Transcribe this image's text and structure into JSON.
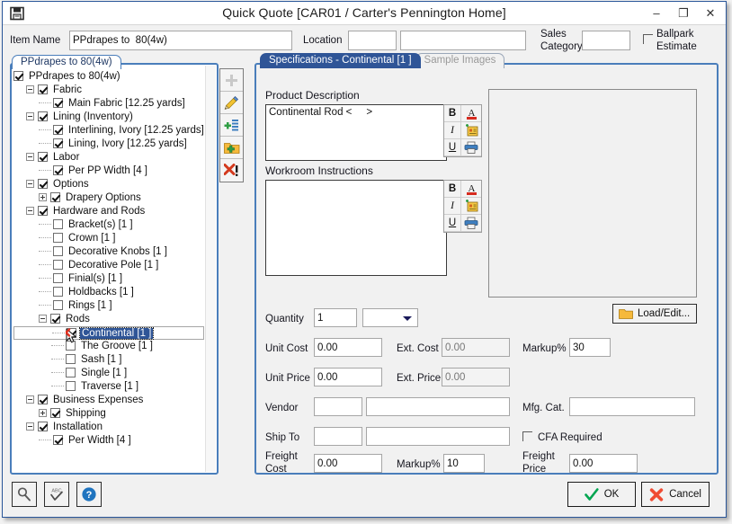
{
  "window": {
    "title": "Quick Quote [CAR01 / Carter's Pennington Home]",
    "icon": "save-disk-icon",
    "minimize": "–",
    "maximize": "❐",
    "close": "✕"
  },
  "header": {
    "item_name_label": "Item Name",
    "item_name_value": "PPdrapes to  80(4w)",
    "location_label": "Location",
    "location_value": "",
    "location_desc_value": "",
    "sales_category_label_line1": "Sales",
    "sales_category_label_line2": "Category",
    "sales_category_value": "",
    "ballpark_label_line1": "Ballpark",
    "ballpark_label_line2": "Estimate",
    "ballpark_checked": false
  },
  "tree": {
    "tab_label": "PPdrapes to  80(4w)",
    "nodes": [
      {
        "label": "PPdrapes to  80(4w)",
        "indent": 0,
        "expander": "none",
        "checked": true,
        "selected": false,
        "dots": false
      },
      {
        "label": "Fabric",
        "indent": 1,
        "expander": "minus",
        "checked": true,
        "selected": false,
        "dots": false
      },
      {
        "label": "Main Fabric [12.25 yards]",
        "indent": 2,
        "expander": "none",
        "checked": true,
        "selected": false,
        "dots": true
      },
      {
        "label": "Lining (Inventory)",
        "indent": 1,
        "expander": "minus",
        "checked": true,
        "selected": false,
        "dots": false
      },
      {
        "label": "Interlining, Ivory [12.25 yards]",
        "indent": 2,
        "expander": "none",
        "checked": true,
        "selected": false,
        "dots": true
      },
      {
        "label": "Lining, Ivory [12.25 yards]",
        "indent": 2,
        "expander": "none",
        "checked": true,
        "selected": false,
        "dots": true
      },
      {
        "label": "Labor",
        "indent": 1,
        "expander": "minus",
        "checked": true,
        "selected": false,
        "dots": false
      },
      {
        "label": "Per PP Width [4 ]",
        "indent": 2,
        "expander": "none",
        "checked": true,
        "selected": false,
        "dots": true
      },
      {
        "label": "Options",
        "indent": 1,
        "expander": "minus",
        "checked": true,
        "selected": false,
        "dots": false
      },
      {
        "label": "Drapery Options",
        "indent": 2,
        "expander": "plus",
        "checked": true,
        "selected": false,
        "dots": false
      },
      {
        "label": "Hardware and Rods",
        "indent": 1,
        "expander": "minus",
        "checked": true,
        "selected": false,
        "dots": false
      },
      {
        "label": "Bracket(s) [1 ]",
        "indent": 2,
        "expander": "none",
        "checked": false,
        "selected": false,
        "dots": true
      },
      {
        "label": "Crown [1 ]",
        "indent": 2,
        "expander": "none",
        "checked": false,
        "selected": false,
        "dots": true
      },
      {
        "label": "Decorative Knobs [1 ]",
        "indent": 2,
        "expander": "none",
        "checked": false,
        "selected": false,
        "dots": true
      },
      {
        "label": "Decorative Pole [1 ]",
        "indent": 2,
        "expander": "none",
        "checked": false,
        "selected": false,
        "dots": true
      },
      {
        "label": "Finial(s) [1 ]",
        "indent": 2,
        "expander": "none",
        "checked": false,
        "selected": false,
        "dots": true
      },
      {
        "label": "Holdbacks [1 ]",
        "indent": 2,
        "expander": "none",
        "checked": false,
        "selected": false,
        "dots": true
      },
      {
        "label": "Rings [1 ]",
        "indent": 2,
        "expander": "none",
        "checked": false,
        "selected": false,
        "dots": true
      },
      {
        "label": "Rods",
        "indent": 2,
        "expander": "minus",
        "checked": true,
        "selected": false,
        "dots": false
      },
      {
        "label": "Continental [1 ]",
        "indent": 3,
        "expander": "none",
        "checked": true,
        "selected": true,
        "dots": true
      },
      {
        "label": "The Groove [1 ]",
        "indent": 3,
        "expander": "none",
        "checked": false,
        "selected": false,
        "dots": true
      },
      {
        "label": "Sash [1 ]",
        "indent": 3,
        "expander": "none",
        "checked": false,
        "selected": false,
        "dots": true
      },
      {
        "label": "Single [1 ]",
        "indent": 3,
        "expander": "none",
        "checked": false,
        "selected": false,
        "dots": true
      },
      {
        "label": "Traverse [1 ]",
        "indent": 3,
        "expander": "none",
        "checked": false,
        "selected": false,
        "dots": true
      },
      {
        "label": "Business Expenses",
        "indent": 1,
        "expander": "minus",
        "checked": true,
        "selected": false,
        "dots": false
      },
      {
        "label": "Shipping",
        "indent": 2,
        "expander": "plus",
        "checked": true,
        "selected": false,
        "dots": false
      },
      {
        "label": "Installation",
        "indent": 1,
        "expander": "minus",
        "checked": true,
        "selected": false,
        "dots": false
      },
      {
        "label": "Per Width [4 ]",
        "indent": 2,
        "expander": "none",
        "checked": true,
        "selected": false,
        "dots": true
      }
    ]
  },
  "midtoolbar": {
    "buttons": [
      {
        "icon": "plus-add-icon",
        "name": "add-item-button"
      },
      {
        "icon": "pencil-edit-icon",
        "name": "edit-item-button"
      },
      {
        "icon": "insert-row-icon",
        "name": "insert-item-button"
      },
      {
        "icon": "folder-add-icon",
        "name": "add-folder-button"
      },
      {
        "icon": "delete-x-icon",
        "name": "delete-item-button"
      }
    ]
  },
  "tabs": {
    "active_label": "Specifications - Continental [1 ]",
    "inactive_label": "Sample Images"
  },
  "spec": {
    "product_description_label": "Product Description",
    "product_description_value": "Continental Rod <     >",
    "workroom_instructions_label": "Workroom Instructions",
    "workroom_instructions_value": "",
    "format_buttons": [
      "B",
      "A",
      "I",
      "tag",
      "U",
      "print"
    ],
    "load_edit_label": "Load/Edit...",
    "image_preview": ""
  },
  "fields": {
    "quantity_label": "Quantity",
    "quantity_value": "1",
    "quantity_unit_value": "",
    "unit_cost_label": "Unit Cost",
    "unit_cost_value": "0.00",
    "ext_cost_label": "Ext. Cost",
    "ext_cost_value": "0.00",
    "markup_label": "Markup%",
    "markup_value": "30",
    "unit_price_label": "Unit Price",
    "unit_price_value": "0.00",
    "ext_price_label": "Ext. Price",
    "ext_price_value": "0.00",
    "vendor_label": "Vendor",
    "vendor_code_value": "",
    "vendor_name_value": "",
    "mfg_cat_label": "Mfg. Cat.",
    "mfg_cat_value": "",
    "ship_to_label": "Ship To",
    "ship_to_code_value": "",
    "ship_to_name_value": "",
    "cfa_label": "CFA Required",
    "cfa_checked": false,
    "freight_cost_label_line1": "Freight",
    "freight_cost_label_line2": "Cost",
    "freight_cost_value": "0.00",
    "freight_markup_label": "Markup%",
    "freight_markup_value": "10",
    "freight_price_label_line1": "Freight",
    "freight_price_label_line2": "Price",
    "freight_price_value": "0.00"
  },
  "footer": {
    "search_icon": "magnifier-icon",
    "spellcheck_icon": "spellcheck-abc-icon",
    "help_icon": "help-question-icon",
    "ok_label": "OK",
    "cancel_label": "Cancel"
  },
  "colors": {
    "accent": "#2f5597",
    "panel_border": "#4a7ebb",
    "selection": "#2f5597",
    "ok_check": "#00a550",
    "cancel_x": "#f04b32",
    "window_bg": "#f1f1f1"
  }
}
